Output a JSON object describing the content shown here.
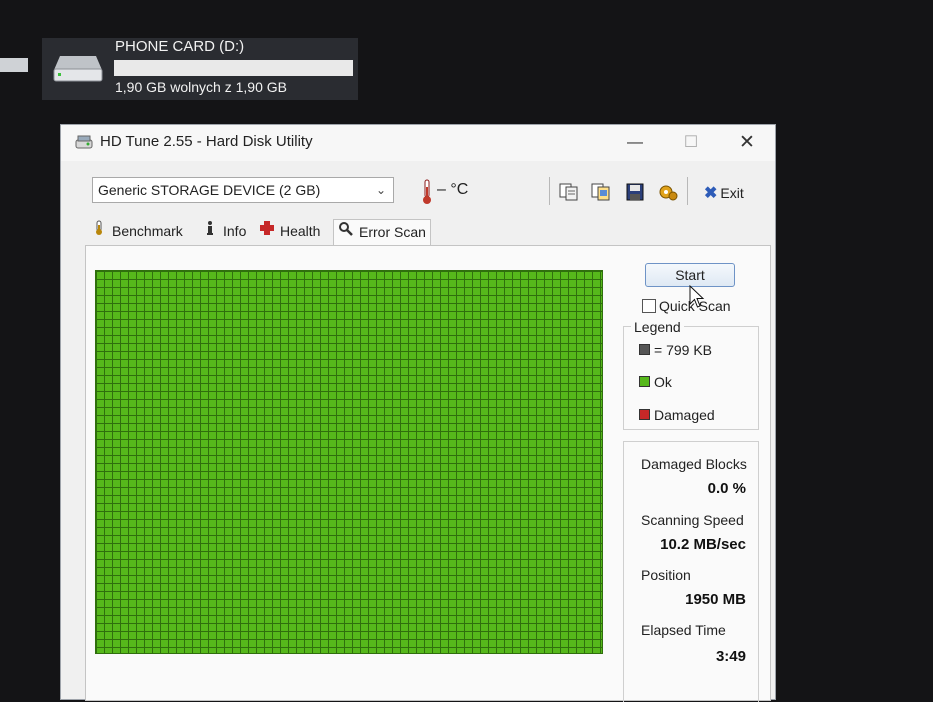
{
  "drive": {
    "name": "PHONE CARD (D:)",
    "free_text": "1,90 GB wolnych z 1,90 GB",
    "used_fraction": 0.0
  },
  "window": {
    "title": "HD Tune 2.55 - Hard Disk Utility",
    "controls": {
      "minimize": "—",
      "maximize": "☐",
      "close": "✕"
    }
  },
  "toolbar": {
    "device": "Generic STORAGE DEVICE (2 GB)",
    "temperature": "– °C",
    "exit_label": "Exit",
    "icons": [
      "copy-icon",
      "copy-screen-icon",
      "save-icon",
      "options-icon",
      "exit-icon"
    ]
  },
  "tabs": [
    {
      "label": "Benchmark",
      "icon": "benchmark-icon"
    },
    {
      "label": "Info",
      "icon": "info-icon"
    },
    {
      "label": "Health",
      "icon": "health-icon"
    },
    {
      "label": "Error Scan",
      "icon": "magnifier-icon",
      "active": true
    }
  ],
  "scan": {
    "start_label": "Start",
    "quick_scan_label": "Quick Scan",
    "quick_scan_checked": false,
    "legend": {
      "title": "Legend",
      "block_size": "= 799 KB",
      "ok": "Ok",
      "damaged": "Damaged"
    },
    "colors": {
      "ok": "#56b81b",
      "damaged": "#c62828",
      "block": "#555555"
    },
    "stats": {
      "damaged_blocks_label": "Damaged Blocks",
      "damaged_blocks_value": "0.0 %",
      "speed_label": "Scanning Speed",
      "speed_value": "10.2 MB/sec",
      "position_label": "Position",
      "position_value": "1950 MB",
      "elapsed_label": "Elapsed Time",
      "elapsed_value": "3:49"
    }
  }
}
